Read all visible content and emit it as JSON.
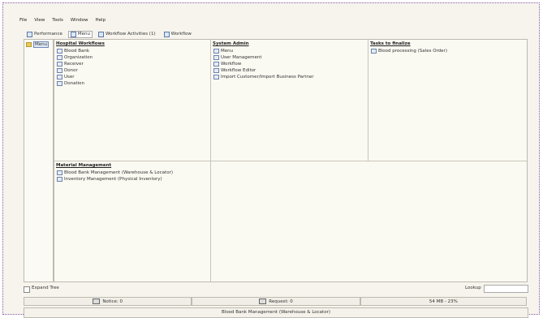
{
  "menu": [
    "File",
    "View",
    "Tools",
    "Window",
    "Help"
  ],
  "tabs": [
    {
      "label": "Performance"
    },
    {
      "label": "Menu"
    },
    {
      "label": "Workflow Activities (1)"
    },
    {
      "label": "Workflow"
    }
  ],
  "tree": {
    "root": "Menu"
  },
  "panels": [
    {
      "title": "Hospital Workflows",
      "items": [
        "Blood Bank",
        "Organization",
        "Receiver",
        "Donor",
        "User",
        "Donation"
      ]
    },
    {
      "title": "System Admin",
      "items": [
        "Menu",
        "User Management",
        "Workflow",
        "Workflow Editor",
        "Import Customer/Import Business Partner"
      ]
    },
    {
      "title": "Tasks to finalize",
      "items": [
        "Blood processing (Sales Order)"
      ]
    },
    {
      "title": "Material Management",
      "items": [
        "Blood Bank Management (Warehouse & Locator)",
        "Inventory Management (Physical Inventory)"
      ]
    }
  ],
  "status": {
    "expand_tree_label": "Expand Tree",
    "lookup_label": "Lookup",
    "lookup_value": ""
  },
  "bottom": {
    "notice": "Notice: 0",
    "request": "Request: 0",
    "memory": "54 MB - 23%"
  },
  "footer": "Blood Bank Management (Warehouse & Locator)"
}
